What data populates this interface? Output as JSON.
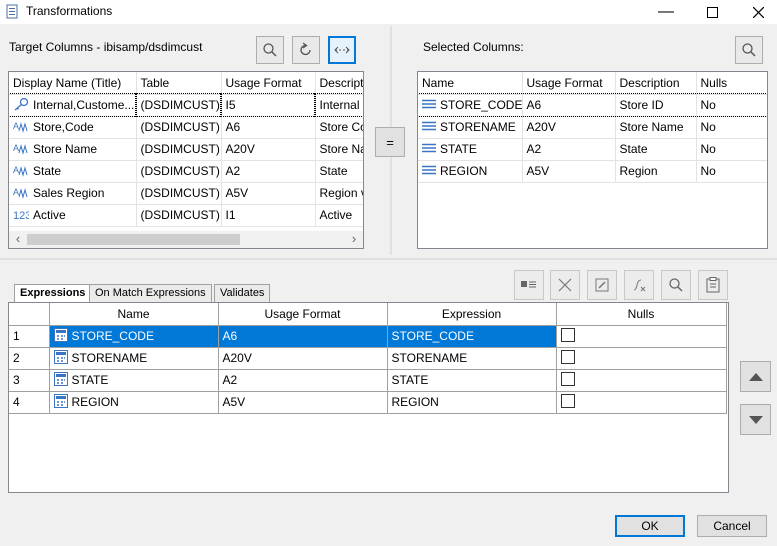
{
  "window": {
    "title": "Transformations"
  },
  "target": {
    "label": "Target Columns - ibisamp/dsdimcust",
    "columns": [
      "Display Name (Title)",
      "Table",
      "Usage Format",
      "Descript"
    ],
    "rows": [
      {
        "icon": "key-icon",
        "name": "Internal,Custome...",
        "table": "(DSDIMCUST)",
        "usage": "I5",
        "desc": "Internal"
      },
      {
        "icon": "text-field-icon",
        "name": "Store,Code",
        "table": "(DSDIMCUST)",
        "usage": "A6",
        "desc": "Store Co"
      },
      {
        "icon": "text-field-icon",
        "name": "Store Name",
        "table": "(DSDIMCUST)",
        "usage": "A20V",
        "desc": "Store Na"
      },
      {
        "icon": "text-field-icon",
        "name": "State",
        "table": "(DSDIMCUST)",
        "usage": "A2",
        "desc": "State"
      },
      {
        "icon": "text-field-icon",
        "name": "Sales Region",
        "table": "(DSDIMCUST)",
        "usage": "A5V",
        "desc": "Region v"
      },
      {
        "icon": "numeric-field-icon",
        "name": "Active",
        "table": "(DSDIMCUST)",
        "usage": "I1",
        "desc": "Active"
      }
    ],
    "scroll_left": "‹",
    "scroll_right": "›"
  },
  "equal_button": "=",
  "selected": {
    "label": "Selected Columns:",
    "columns": [
      "Name",
      "Usage Format",
      "Description",
      "Nulls"
    ],
    "rows": [
      {
        "name": "STORE_CODE",
        "usage": "A6",
        "desc": "Store ID",
        "nulls": "No"
      },
      {
        "name": "STORENAME",
        "usage": "A20V",
        "desc": "Store Name",
        "nulls": "No"
      },
      {
        "name": "STATE",
        "usage": "A2",
        "desc": "State",
        "nulls": "No"
      },
      {
        "name": "REGION",
        "usage": "A5V",
        "desc": "Region",
        "nulls": "No"
      }
    ]
  },
  "tabs": [
    "Expressions",
    "On Match Expressions",
    "Validates"
  ],
  "expressions": {
    "columns": [
      "Name",
      "Usage Format",
      "Expression",
      "Nulls"
    ],
    "rows": [
      {
        "num": "1",
        "name": "STORE_CODE",
        "usage": "A6",
        "expr": "STORE_CODE",
        "selected": true
      },
      {
        "num": "2",
        "name": "STORENAME",
        "usage": "A20V",
        "expr": "STORENAME",
        "selected": false
      },
      {
        "num": "3",
        "name": "STATE",
        "usage": "A2",
        "expr": "STATE",
        "selected": false
      },
      {
        "num": "4",
        "name": "REGION",
        "usage": "A5V",
        "expr": "REGION",
        "selected": false
      }
    ]
  },
  "buttons": {
    "ok": "OK",
    "cancel": "Cancel"
  },
  "colors": {
    "accent": "#0078d7"
  }
}
